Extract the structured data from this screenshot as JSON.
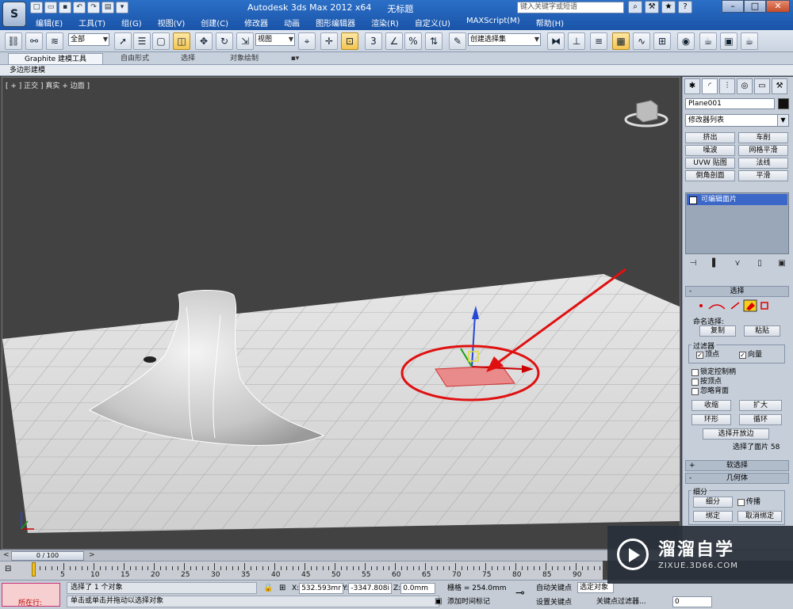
{
  "window": {
    "title_app": "Autodesk 3ds Max  2012 x64",
    "title_doc": "无标题",
    "search_placeholder": "键入关键字或短语",
    "app_logo": "S"
  },
  "menu": [
    "编辑(E)",
    "工具(T)",
    "组(G)",
    "视图(V)",
    "创建(C)",
    "修改器",
    "动画",
    "图形编辑器",
    "渲染(R)",
    "自定义(U)",
    "MAXScript(M)",
    "帮助(H)"
  ],
  "toolbar": {
    "selection_filter": "全部",
    "ref_coord": "视图",
    "named_selection": "创建选择集"
  },
  "ribbon": {
    "tabs": [
      "Graphite 建模工具",
      "自由形式",
      "选择",
      "对象绘制"
    ],
    "active_tab": "Graphite 建模工具",
    "sub_label": "多边形建模"
  },
  "viewport": {
    "label": "[ + ] 正交 ] 真实 + 边面 ]"
  },
  "command_panel": {
    "object_name": "Plane001",
    "modifier_list": "修改器列表",
    "modifier_buttons": [
      "挤出",
      "车削",
      "噪波",
      "网格平滑",
      "UVW 贴图",
      "法线",
      "倒角剖面",
      "平滑"
    ],
    "stack_item": "可编辑面片",
    "selection_rollout": {
      "title": "选择",
      "named_sel_label": "命名选择:",
      "copy": "复制",
      "paste": "粘贴",
      "filter_label": "过滤器",
      "vertex": "顶点",
      "vector": "向量",
      "lock_handles": "锁定控制柄",
      "by_vertex": "按顶点",
      "ignore_back": "忽略背面",
      "shrink": "收缩",
      "grow": "扩大",
      "ring": "环形",
      "loop": "循环",
      "select_open_edges": "选择开放边",
      "status": "选择了面片 58"
    },
    "soft_sel": "软选择",
    "geometry": "几何体",
    "subdivide_label": "细分",
    "subdivide": "细分",
    "propagate": "传播",
    "bind": "绑定",
    "unbind": "取消绑定"
  },
  "timeline": {
    "frame": "0 / 100",
    "ticks": [
      "5",
      "10",
      "15",
      "20",
      "25",
      "30",
      "35",
      "40",
      "45",
      "50",
      "55",
      "60",
      "65",
      "70",
      "75",
      "80",
      "85",
      "90"
    ]
  },
  "status": {
    "running": "所在行:",
    "msg1": "选择了 1 个对象",
    "msg2": "单击或单击并拖动以选择对象",
    "x_label": "X:",
    "x_val": "532.593mr",
    "y_label": "Y:",
    "y_val": "-3347.808i",
    "z_label": "Z:",
    "z_val": "0.0mm",
    "grid": "栅格 = 254.0mm",
    "add_time_tag": "添加时间标记",
    "auto_key": "自动关键点",
    "set_key": "设置关键点",
    "sel_filter": "选定对象",
    "key_filters": "关键点过滤器...",
    "frame_field": "0"
  },
  "watermark": {
    "title": "溜溜自学",
    "url": "ZIXUE.3D66.COM"
  },
  "colors": {
    "viewport_bg": "#424242",
    "selected_face": "#e98b8b",
    "annotation": "#e01010"
  }
}
